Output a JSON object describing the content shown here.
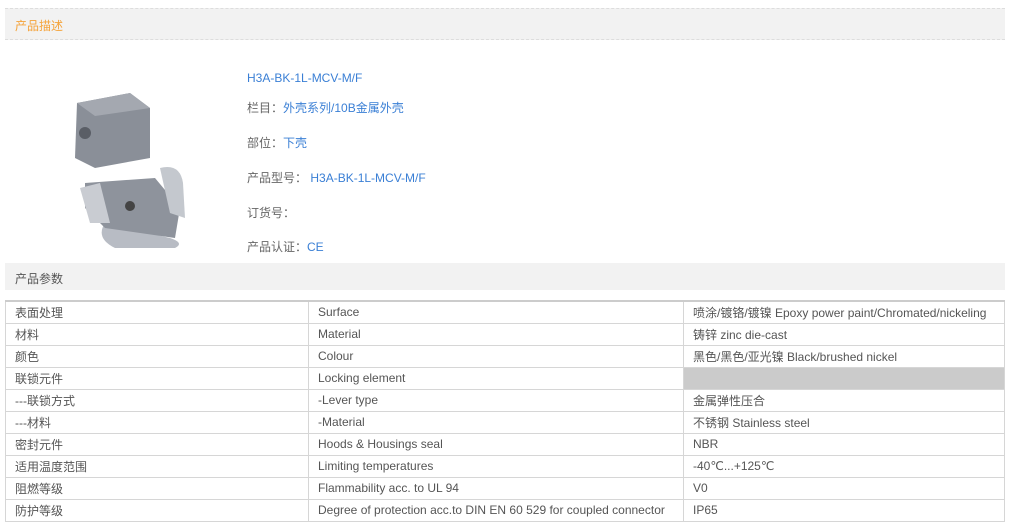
{
  "description_header": "产品描述",
  "params_header": "产品参数",
  "product": {
    "title": "H3A-BK-1L-MCV-M/F",
    "category_label": "栏目：",
    "category_value": "外壳系列/10B金属外壳",
    "position_label": "部位：",
    "position_value": "下壳",
    "model_label": "产品型号：",
    "model_value": "H3A-BK-1L-MCV-M/F",
    "order_label": "订货号：",
    "order_value": "",
    "cert_label": "产品认证：",
    "cert_value": "CE"
  },
  "params": [
    {
      "cn": "表面处理",
      "en": "Surface",
      "value": "喷涂/镀铬/镀镍 Epoxy power paint/Chromated/nickeling"
    },
    {
      "cn": "材料",
      "en": "Material",
      "value": "铸锌 zinc die-cast"
    },
    {
      "cn": "颜色",
      "en": "Colour",
      "value": "黑色/黑色/亚光镍 Black/brushed nickel"
    },
    {
      "cn": "联锁元件",
      "en": "Locking element",
      "value": ""
    },
    {
      "cn": "---联锁方式",
      "en": "-Lever type",
      "value": "金属弹性压合"
    },
    {
      "cn": "---材料",
      "en": "-Material",
      "value": "不锈钢 Stainless steel"
    },
    {
      "cn": "密封元件",
      "en": "Hoods & Housings seal",
      "value": "NBR"
    },
    {
      "cn": "适用温度范围",
      "en": "Limiting temperatures",
      "value": "-40℃...+125℃"
    },
    {
      "cn": "阻燃等级",
      "en": "Flammability acc. to UL 94",
      "value": "V0"
    },
    {
      "cn": "防护等级",
      "en": "Degree of protection acc.to DIN EN 60 529 for coupled connector",
      "value": "IP65"
    }
  ]
}
